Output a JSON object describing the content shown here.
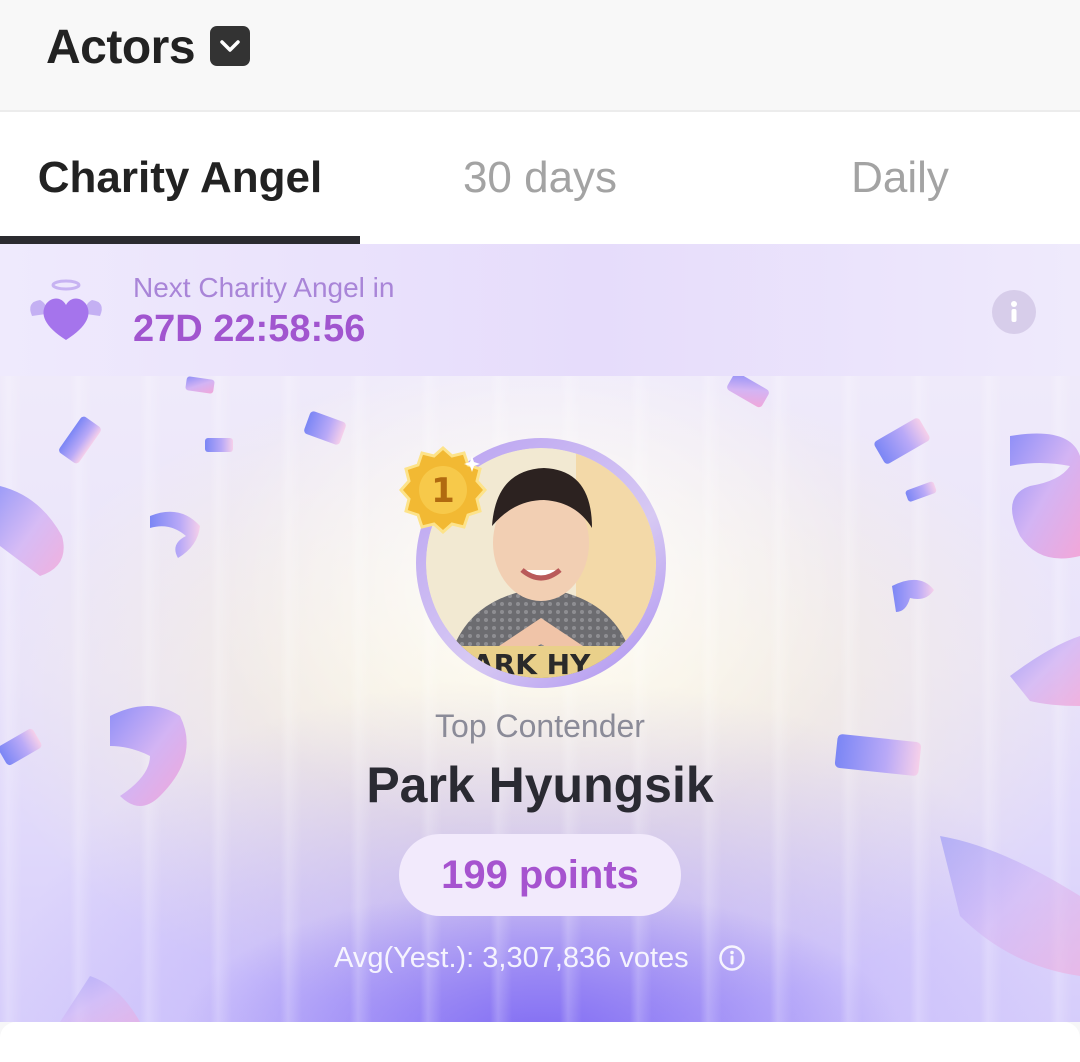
{
  "header": {
    "title": "Actors",
    "dropdown_icon": "chevron-down-icon"
  },
  "tabs": [
    {
      "label": "Charity Angel",
      "active": true
    },
    {
      "label": "30 days",
      "active": false
    },
    {
      "label": "Daily",
      "active": false
    }
  ],
  "countdown": {
    "label": "Next Charity Angel in",
    "timer": "27D 22:58:56",
    "icon": "angel-heart-icon"
  },
  "hero": {
    "rank": "1",
    "contender_label": "Top Contender",
    "name": "Park Hyungsik",
    "points": "199 points",
    "avg": "Avg(Yest.): 3,307,836 votes"
  },
  "colors": {
    "accent": "#a155cf",
    "countdown_bg": "#e8e0fb",
    "tab_active": "#222222"
  }
}
